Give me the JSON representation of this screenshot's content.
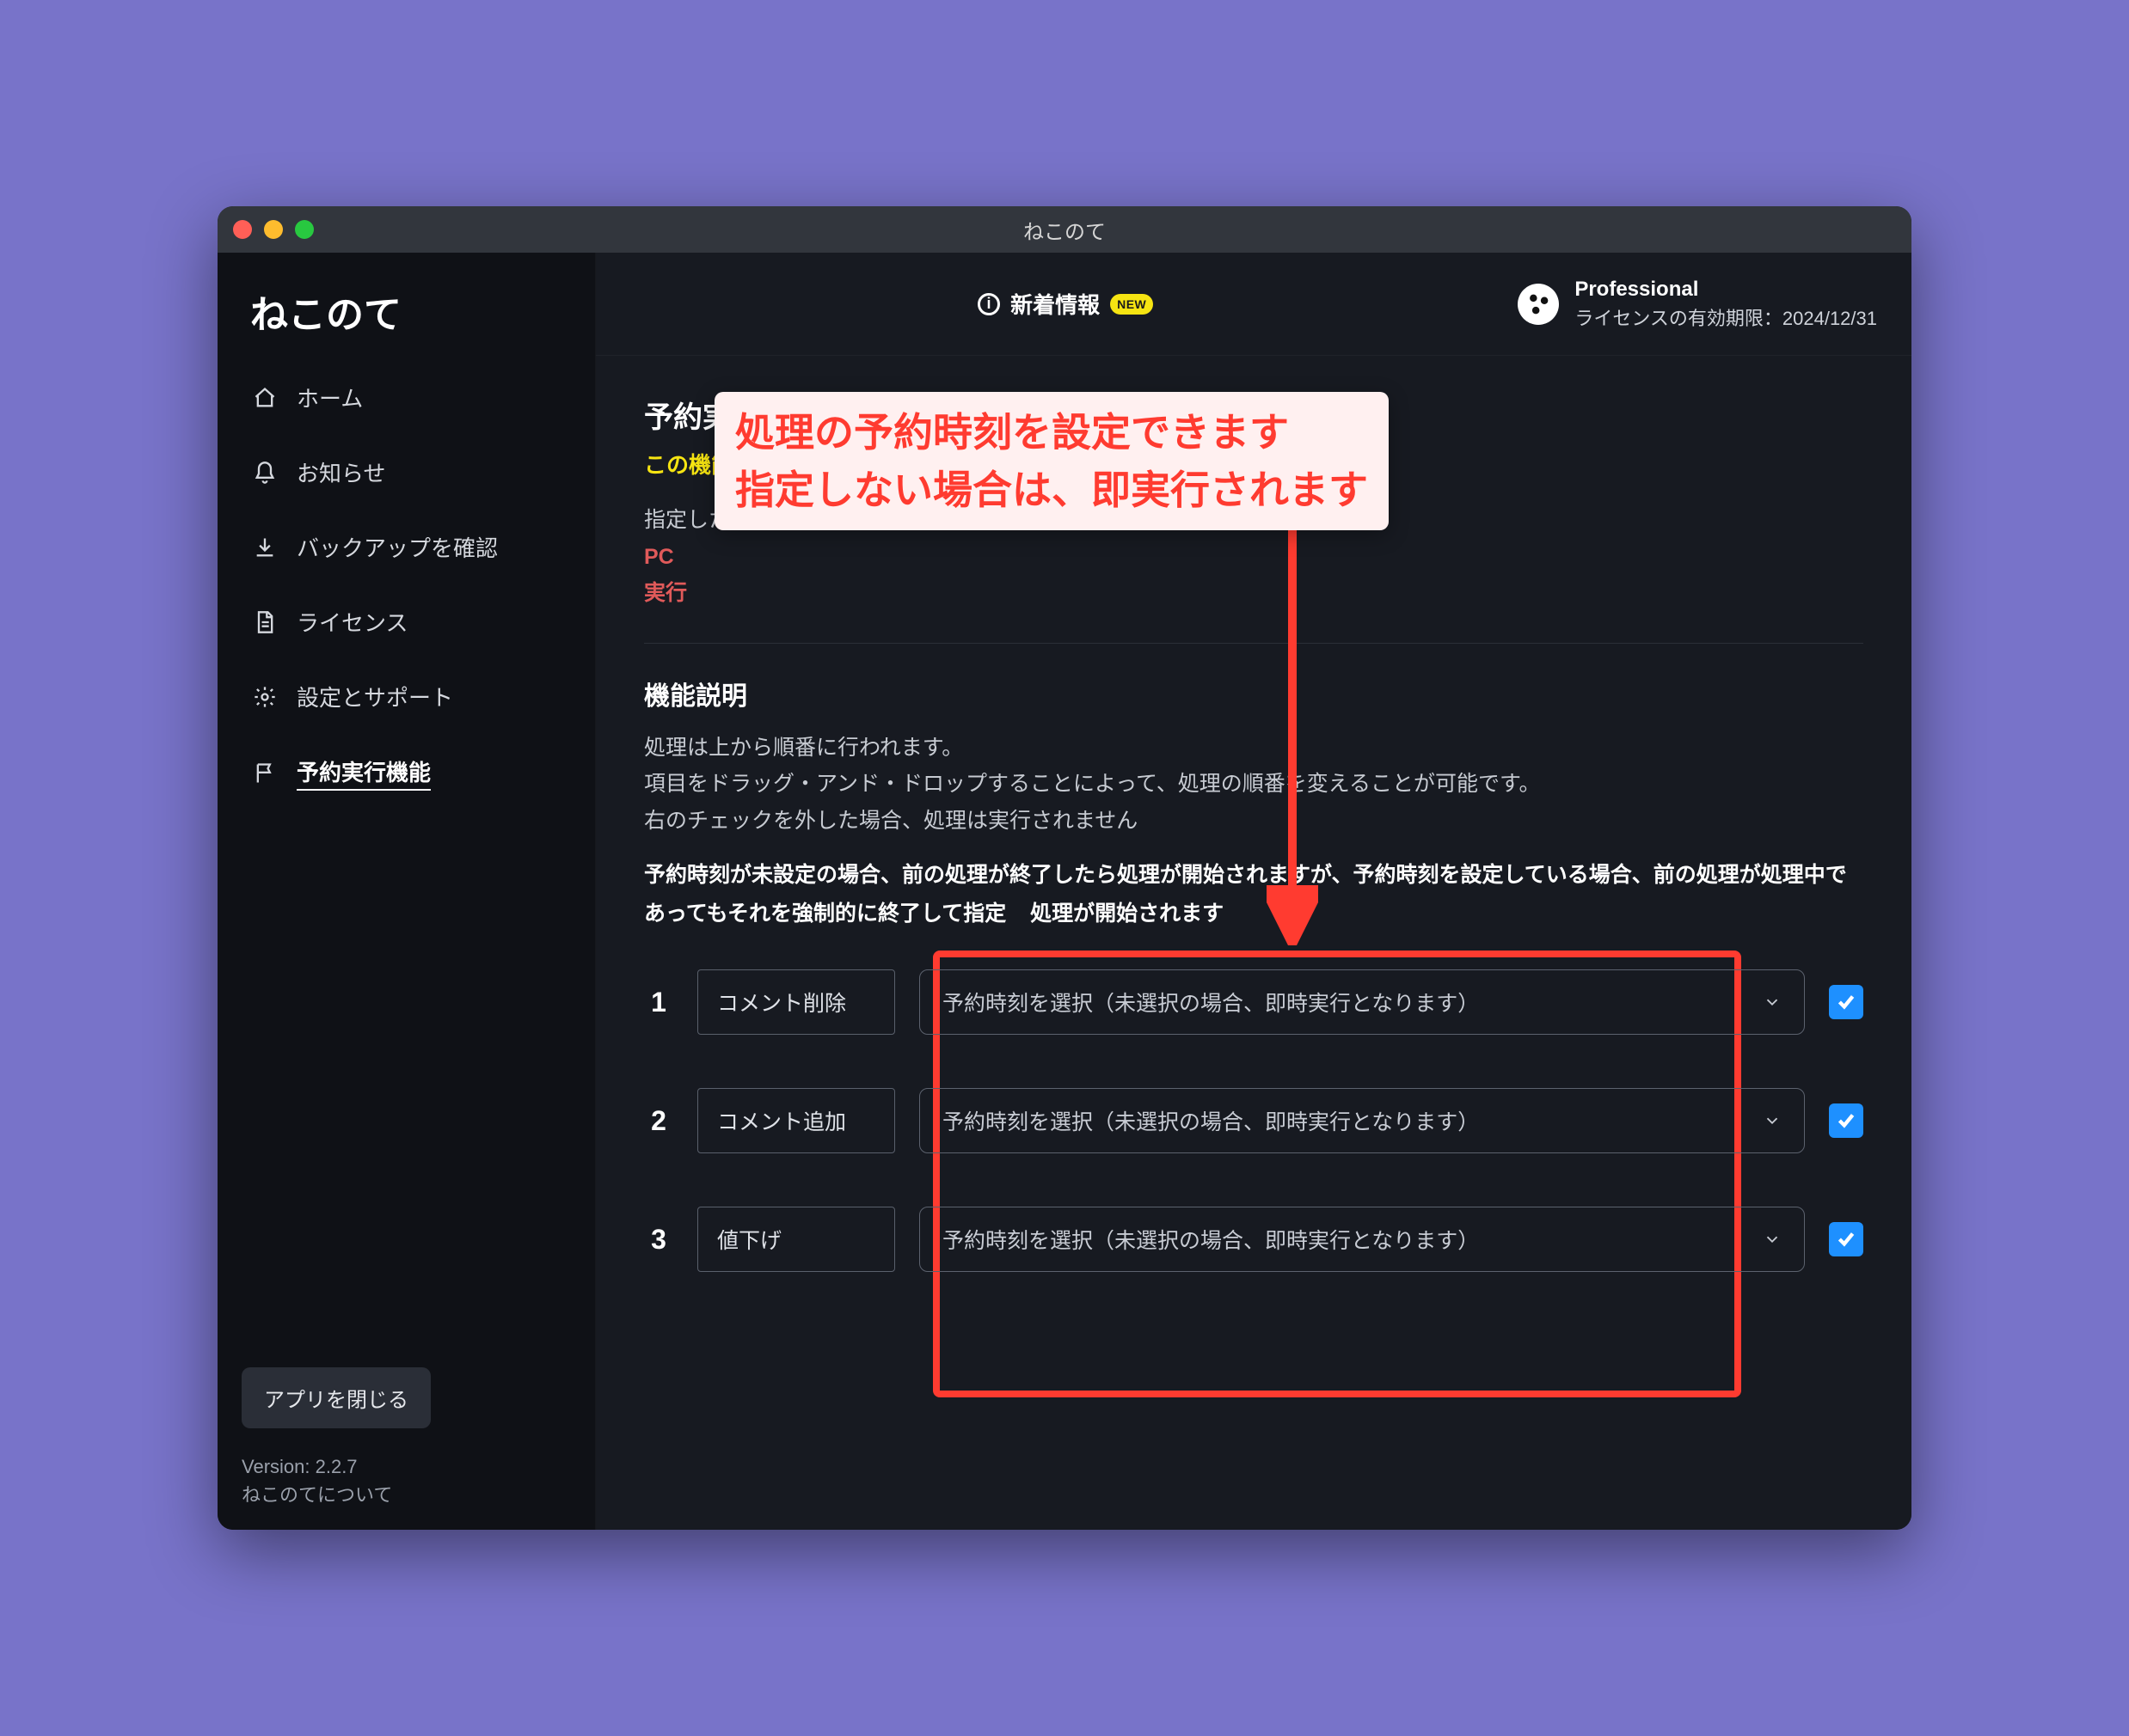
{
  "window_title": "ねこのて",
  "app_name": "ねこのて",
  "sidebar": {
    "items": [
      {
        "label": "ホーム"
      },
      {
        "label": "お知らせ"
      },
      {
        "label": "バックアップを確認"
      },
      {
        "label": "ライセンス"
      },
      {
        "label": "設定とサポート"
      },
      {
        "label": "予約実行機能"
      }
    ],
    "close_app": "アプリを閉じる",
    "version_label": "Version: 2.2.7",
    "about_label": "ねこのてについて"
  },
  "header": {
    "news_label": "新着情報",
    "new_badge": "NEW",
    "plan": "Professional",
    "license_expiry": "ライセンスの有効期限：2024/12/31"
  },
  "page": {
    "title": "予約実行機能",
    "beta_prefix": "この機能",
    "p_schedule": "指定した時",
    "p_pc_prefix": "PC",
    "p_exec_prefix": "実行",
    "desc_title": "機能説明",
    "desc_line1": "処理は上から順番に行われます。",
    "desc_line2": "項目をドラッグ・アンド・ドロップすることによって、処理の順番を変えることが可能です。",
    "desc_line3": "右のチェックを外した場合、処理は実行されません",
    "desc_bold": "予約時刻が未設定の場合、前の処理が終了したら処理が開始されますが、予約時刻を設定している場合、前の処理が処理中であってもそれを強制的に終了して指定",
    "desc_bold_tail": "処理が開始されます",
    "select_placeholder": "予約時刻を選択（未選択の場合、即時実行となります）",
    "rows": [
      {
        "num": "1",
        "label": "コメント削除"
      },
      {
        "num": "2",
        "label": "コメント追加"
      },
      {
        "num": "3",
        "label": "値下げ"
      }
    ]
  },
  "annotation": {
    "line1": "処理の予約時刻を設定できます",
    "line2": "指定しない場合は、即実行されます"
  }
}
